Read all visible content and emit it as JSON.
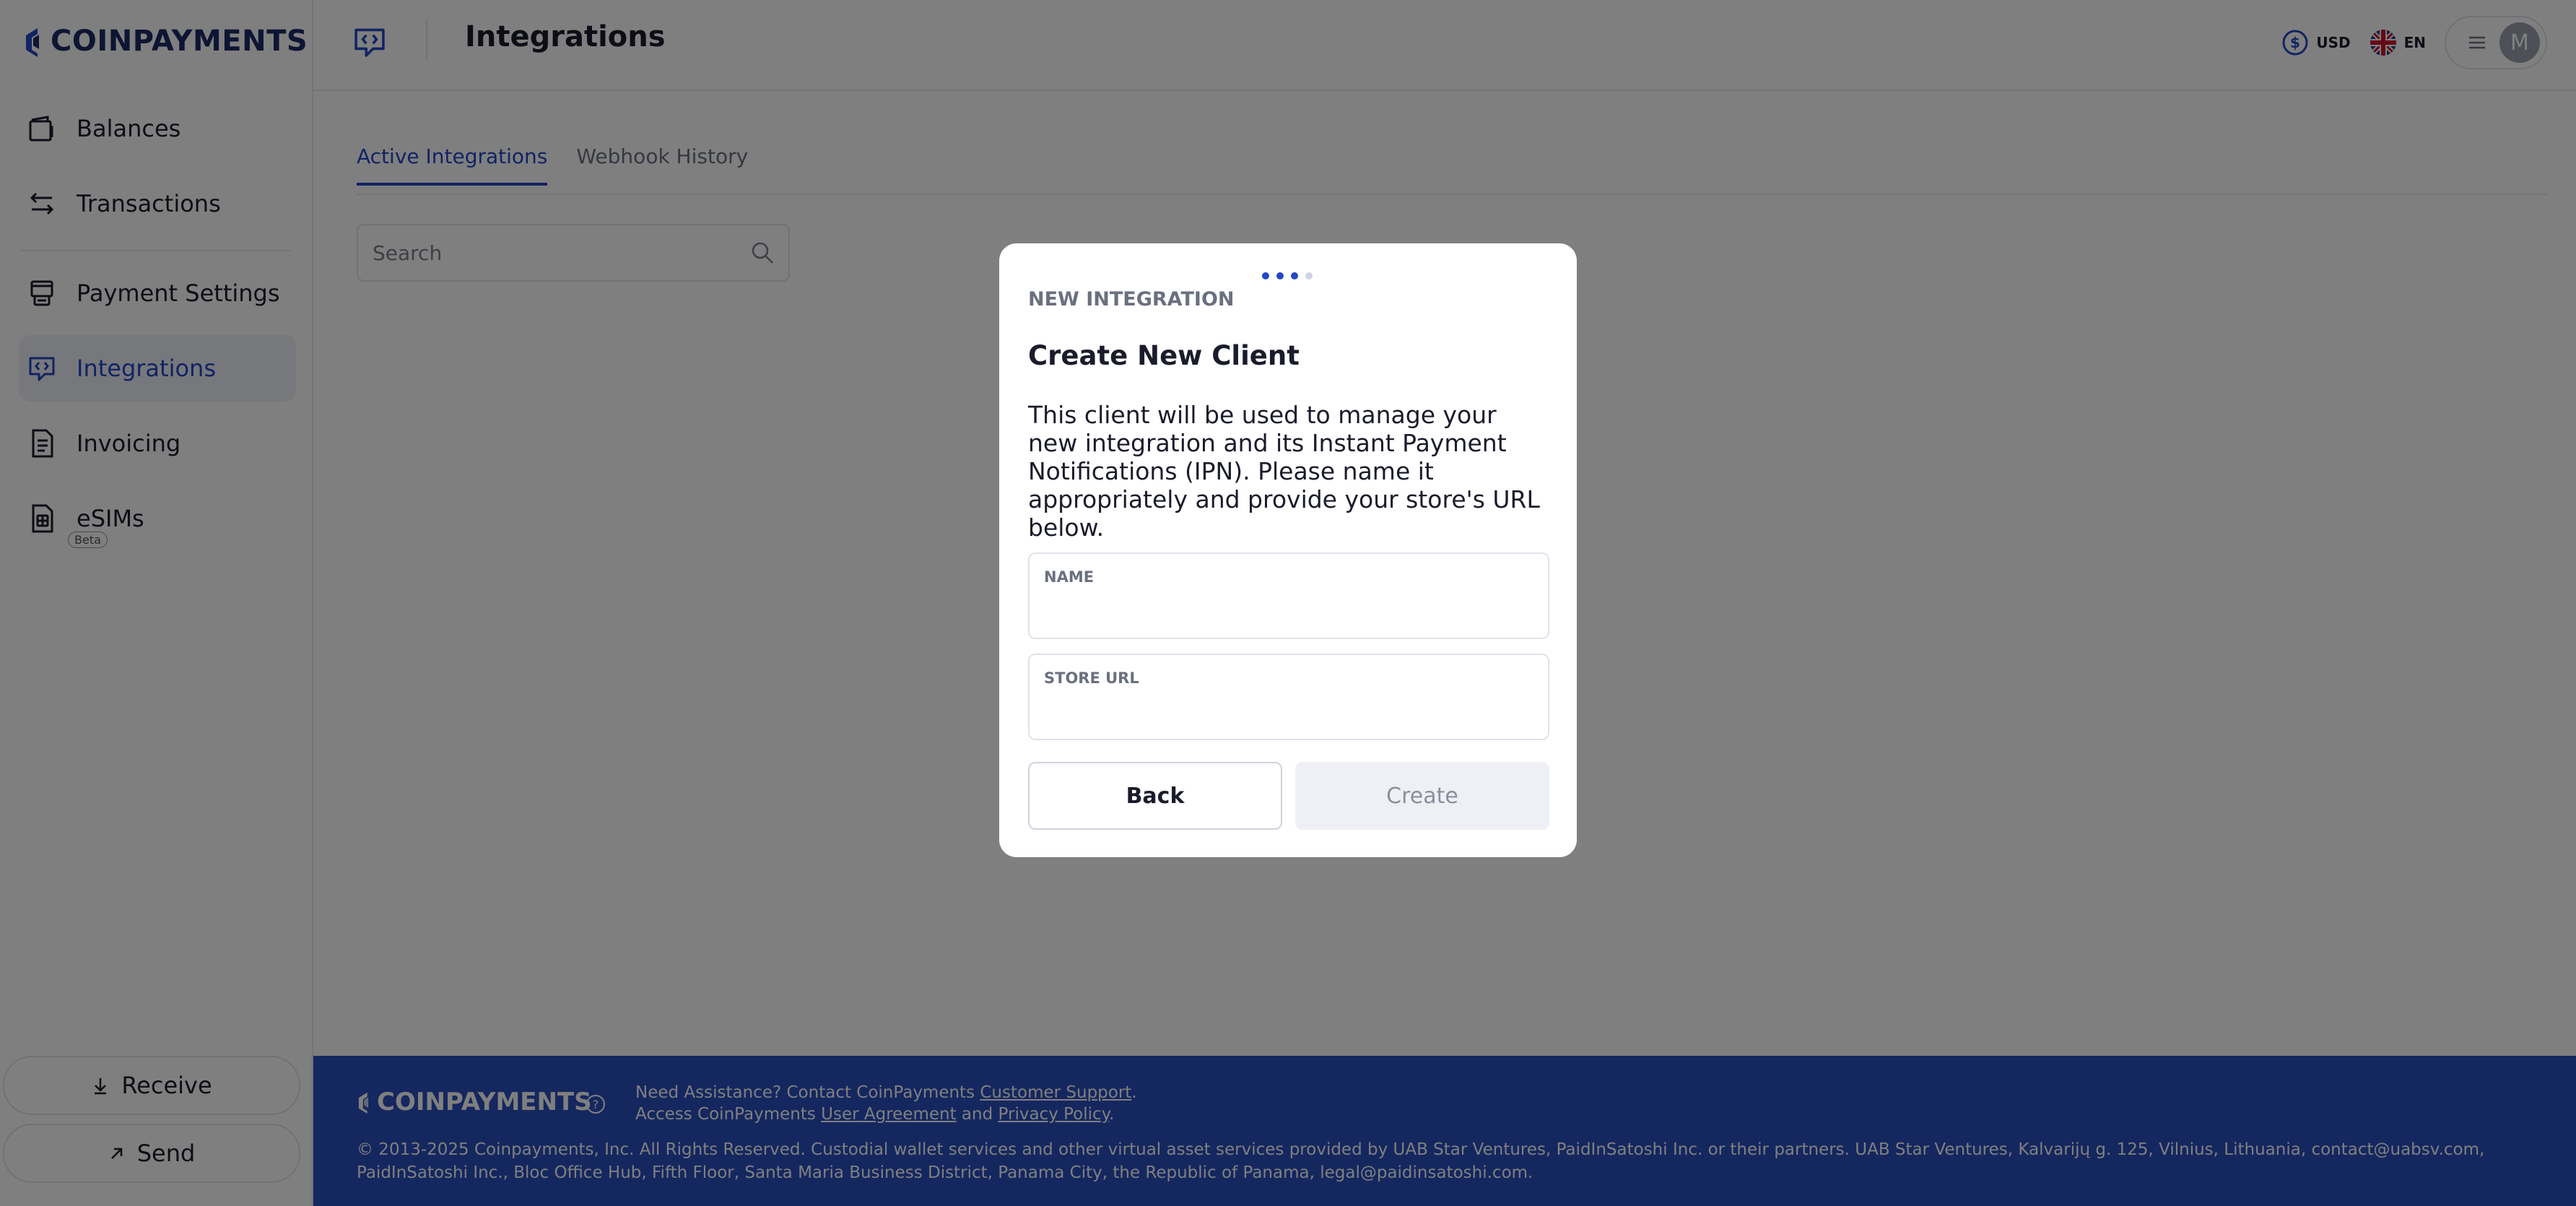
{
  "brand": {
    "name": "COINPAYMENTS",
    "accent": "#2347c7",
    "footer_bg": "#2a4fbf"
  },
  "sidebar": {
    "items": [
      {
        "label": "Balances",
        "icon": "wallet-icon"
      },
      {
        "label": "Transactions",
        "icon": "transfer-arrows-icon"
      },
      {
        "label": "Payment Settings",
        "icon": "pos-terminal-icon"
      },
      {
        "label": "Integrations",
        "icon": "integrations-chat-icon",
        "active": true
      },
      {
        "label": "Invoicing",
        "icon": "invoice-document-icon"
      },
      {
        "label": "eSIMs",
        "icon": "esim-card-icon",
        "badge": "Beta"
      }
    ],
    "receive_label": "Receive",
    "send_label": "Send"
  },
  "header": {
    "title": "Integrations",
    "currency": "USD",
    "language": "EN",
    "avatar_initial": "M"
  },
  "main": {
    "tabs": [
      {
        "label": "Active Integrations",
        "active": true
      },
      {
        "label": "Webhook History",
        "active": false
      }
    ],
    "search": {
      "placeholder": "Search"
    }
  },
  "modal": {
    "step_label": "NEW INTEGRATION",
    "step_current": 3,
    "step_total": 4,
    "title": "Create New Client",
    "description": "This client will be used to manage your new integration and its Instant Payment Notifications (IPN). Please name it appropriately and provide your store's URL below.",
    "fields": [
      {
        "label": "NAME",
        "value": ""
      },
      {
        "label": "STORE URL",
        "value": ""
      }
    ],
    "back_label": "Back",
    "create_label": "Create"
  },
  "footer": {
    "assist_prefix": "Need Assistance? Contact CoinPayments ",
    "assist_link": "Customer Support",
    "assist_suffix": ".",
    "access_prefix": "Access CoinPayments ",
    "user_agreement": "User Agreement",
    "access_and": " and ",
    "privacy_policy": "Privacy Policy",
    "access_suffix": ".",
    "legal": "© 2013-2025 Coinpayments, Inc. All Rights Reserved. Custodial wallet services and other virtual asset services provided by UAB Star Ventures, PaidInSatoshi Inc. or their partners. UAB Star Ventures, Kalvarijų g. 125, Vilnius, Lithuania, contact@uabsv.com, PaidInSatoshi Inc., Bloc Office Hub, Fifth Floor, Santa Maria Business District, Panama City, the Republic of Panama, legal@paidinsatoshi.com."
  }
}
